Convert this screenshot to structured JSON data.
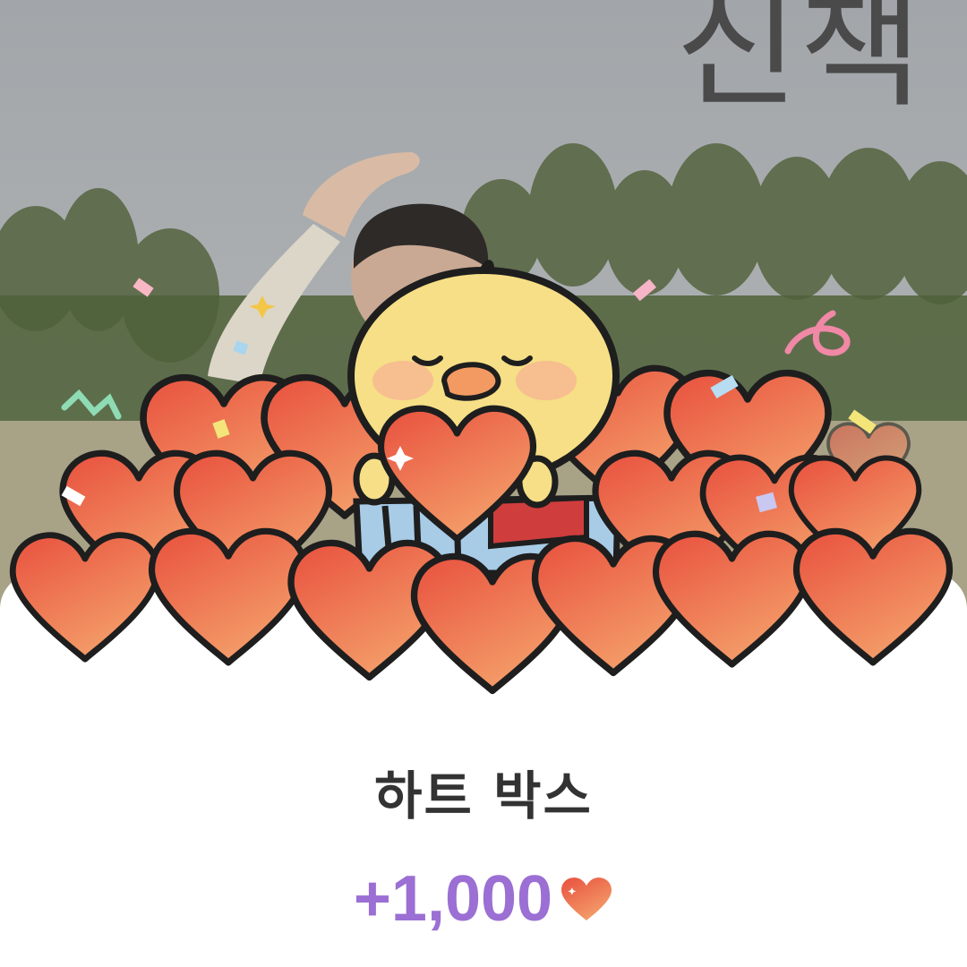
{
  "video": {
    "overlay_text": "신책"
  },
  "reward": {
    "title": "하트 박스",
    "amount": "+1,000",
    "amount_icon": "heart-icon",
    "amount_color": "#9b6fd3"
  },
  "colors": {
    "heart_fill": "#ee6a4a",
    "chick_body": "#f6df86",
    "box_blue": "#a8cbe6"
  }
}
